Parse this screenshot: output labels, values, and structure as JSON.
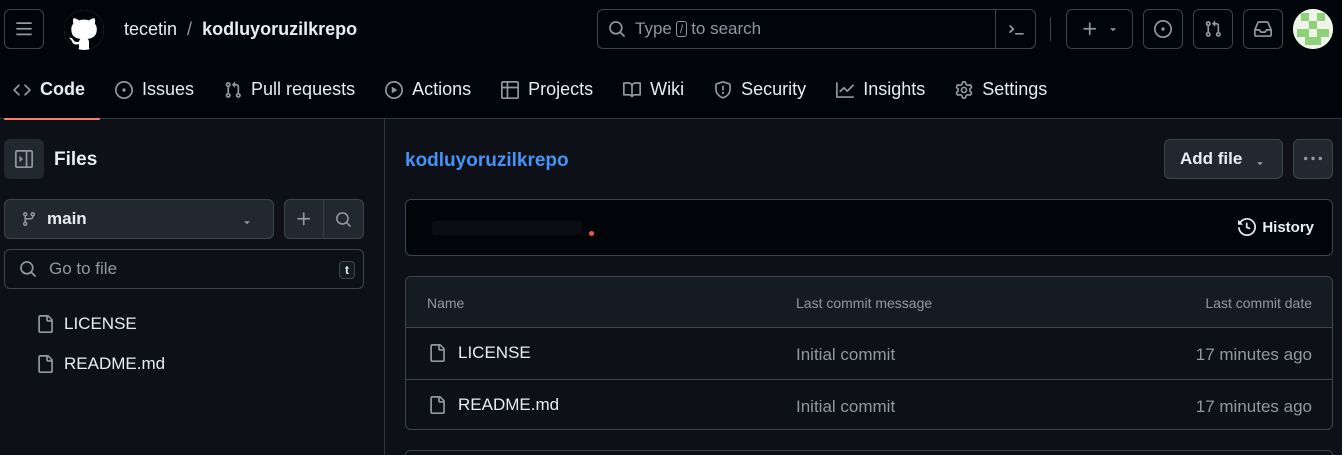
{
  "header": {
    "owner": "tecetin",
    "separator": "/",
    "repo": "kodluyoruzilkrepo",
    "search": {
      "before": "Type",
      "key": "/",
      "after": "to search"
    }
  },
  "tabs": [
    {
      "label": "Code",
      "icon": "code-icon",
      "selected": true
    },
    {
      "label": "Issues",
      "icon": "issue-opened-icon"
    },
    {
      "label": "Pull requests",
      "icon": "git-pull-request-icon"
    },
    {
      "label": "Actions",
      "icon": "play-icon"
    },
    {
      "label": "Projects",
      "icon": "table-icon"
    },
    {
      "label": "Wiki",
      "icon": "book-icon"
    },
    {
      "label": "Security",
      "icon": "shield-icon"
    },
    {
      "label": "Insights",
      "icon": "graph-icon"
    },
    {
      "label": "Settings",
      "icon": "gear-icon"
    }
  ],
  "sidebar": {
    "title": "Files",
    "branch": "main",
    "goto_placeholder": "Go to file",
    "goto_shortcut": "t",
    "tree": [
      "LICENSE",
      "README.md"
    ]
  },
  "main": {
    "repo_link": "kodluyoruzilkrepo",
    "add_file": "Add file",
    "history": "History",
    "table": {
      "headers": {
        "name": "Name",
        "message": "Last commit message",
        "date": "Last commit date"
      },
      "rows": [
        {
          "name": "LICENSE",
          "message": "Initial commit",
          "date": "17 minutes ago"
        },
        {
          "name": "README.md",
          "message": "Initial commit",
          "date": "17 minutes ago"
        }
      ]
    }
  },
  "colors": {
    "background": "#0d1117",
    "header": "#010409",
    "accent_link": "#4493f8",
    "tab_underline": "#f78166",
    "border": "#3d444d"
  }
}
